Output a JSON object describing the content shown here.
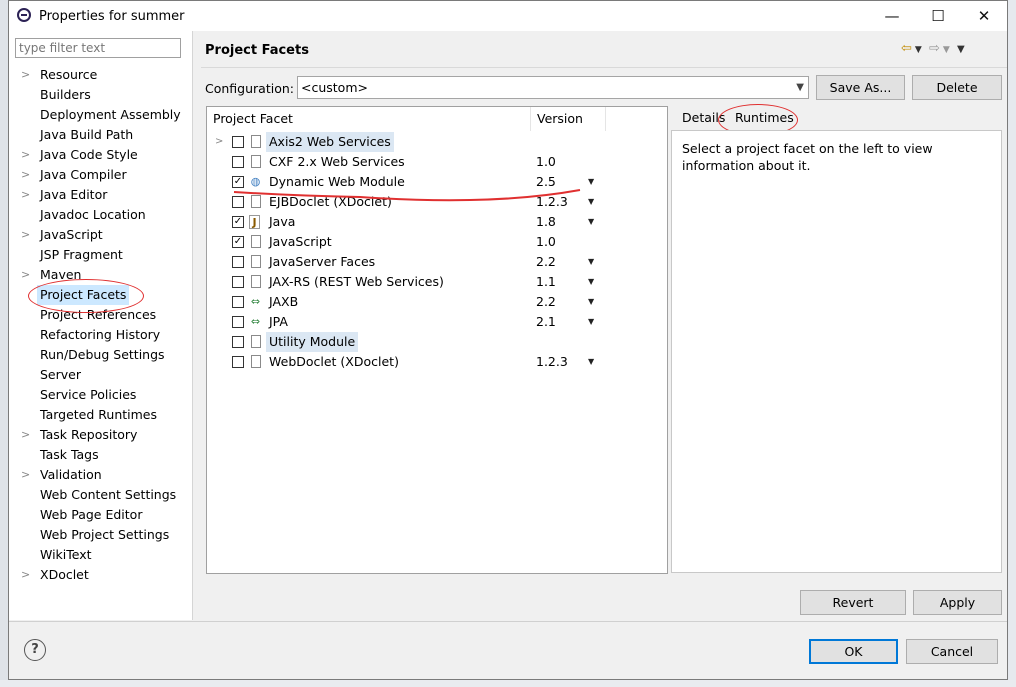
{
  "window": {
    "title": "Properties for summer",
    "minimize": "—",
    "maximize": "☐",
    "close": "✕"
  },
  "filter": {
    "placeholder": "type filter text"
  },
  "sidebar": {
    "items": [
      {
        "label": "Resource",
        "expandable": true
      },
      {
        "label": "Builders",
        "expandable": false
      },
      {
        "label": "Deployment Assembly",
        "expandable": false
      },
      {
        "label": "Java Build Path",
        "expandable": false
      },
      {
        "label": "Java Code Style",
        "expandable": true
      },
      {
        "label": "Java Compiler",
        "expandable": true
      },
      {
        "label": "Java Editor",
        "expandable": true
      },
      {
        "label": "Javadoc Location",
        "expandable": false
      },
      {
        "label": "JavaScript",
        "expandable": true
      },
      {
        "label": "JSP Fragment",
        "expandable": false
      },
      {
        "label": "Maven",
        "expandable": true
      },
      {
        "label": "Project Facets",
        "expandable": false,
        "selected": true
      },
      {
        "label": "Project References",
        "expandable": false
      },
      {
        "label": "Refactoring History",
        "expandable": false
      },
      {
        "label": "Run/Debug Settings",
        "expandable": false
      },
      {
        "label": "Server",
        "expandable": false
      },
      {
        "label": "Service Policies",
        "expandable": false
      },
      {
        "label": "Targeted Runtimes",
        "expandable": false
      },
      {
        "label": "Task Repository",
        "expandable": true
      },
      {
        "label": "Task Tags",
        "expandable": false
      },
      {
        "label": "Validation",
        "expandable": true
      },
      {
        "label": "Web Content Settings",
        "expandable": false
      },
      {
        "label": "Web Page Editor",
        "expandable": false
      },
      {
        "label": "Web Project Settings",
        "expandable": false
      },
      {
        "label": "WikiText",
        "expandable": false
      },
      {
        "label": "XDoclet",
        "expandable": true
      }
    ]
  },
  "header": {
    "title": "Project Facets"
  },
  "config": {
    "label": "Configuration:",
    "value": "<custom>",
    "save_as": "Save As...",
    "delete": "Delete"
  },
  "facets": {
    "col_facet": "Project Facet",
    "col_version": "Version",
    "rows": [
      {
        "name": "Axis2 Web Services",
        "version": "",
        "checked": false,
        "icon": "doc",
        "expand": true,
        "highlight": true,
        "dd": false
      },
      {
        "name": "CXF 2.x Web Services",
        "version": "1.0",
        "checked": false,
        "icon": "doc",
        "expand": false,
        "highlight": false,
        "dd": false
      },
      {
        "name": "Dynamic Web Module",
        "version": "2.5",
        "checked": true,
        "icon": "globe",
        "expand": false,
        "highlight": false,
        "dd": true
      },
      {
        "name": "EJBDoclet (XDoclet)",
        "version": "1.2.3",
        "checked": false,
        "icon": "doc",
        "expand": false,
        "highlight": false,
        "dd": true
      },
      {
        "name": "Java",
        "version": "1.8",
        "checked": true,
        "icon": "java",
        "expand": false,
        "highlight": false,
        "dd": true
      },
      {
        "name": "JavaScript",
        "version": "1.0",
        "checked": true,
        "icon": "doc",
        "expand": false,
        "highlight": false,
        "dd": false
      },
      {
        "name": "JavaServer Faces",
        "version": "2.2",
        "checked": false,
        "icon": "doc",
        "expand": false,
        "highlight": false,
        "dd": true
      },
      {
        "name": "JAX-RS (REST Web Services)",
        "version": "1.1",
        "checked": false,
        "icon": "doc",
        "expand": false,
        "highlight": false,
        "dd": true
      },
      {
        "name": "JAXB",
        "version": "2.2",
        "checked": false,
        "icon": "arrows",
        "expand": false,
        "highlight": false,
        "dd": true
      },
      {
        "name": "JPA",
        "version": "2.1",
        "checked": false,
        "icon": "arrows",
        "expand": false,
        "highlight": false,
        "dd": true
      },
      {
        "name": "Utility Module",
        "version": "",
        "checked": false,
        "icon": "doc",
        "expand": false,
        "highlight": true,
        "dd": false
      },
      {
        "name": "WebDoclet (XDoclet)",
        "version": "1.2.3",
        "checked": false,
        "icon": "doc",
        "expand": false,
        "highlight": false,
        "dd": true
      }
    ]
  },
  "details": {
    "tab_details": "Details",
    "tab_runtimes": "Runtimes",
    "text": "Select a project facet on the left to view information about it."
  },
  "buttons": {
    "revert": "Revert",
    "apply": "Apply",
    "ok": "OK",
    "cancel": "Cancel"
  },
  "colors": {
    "annotation": "#e03030",
    "selection": "#cce8ff",
    "focus": "#0078d7"
  }
}
